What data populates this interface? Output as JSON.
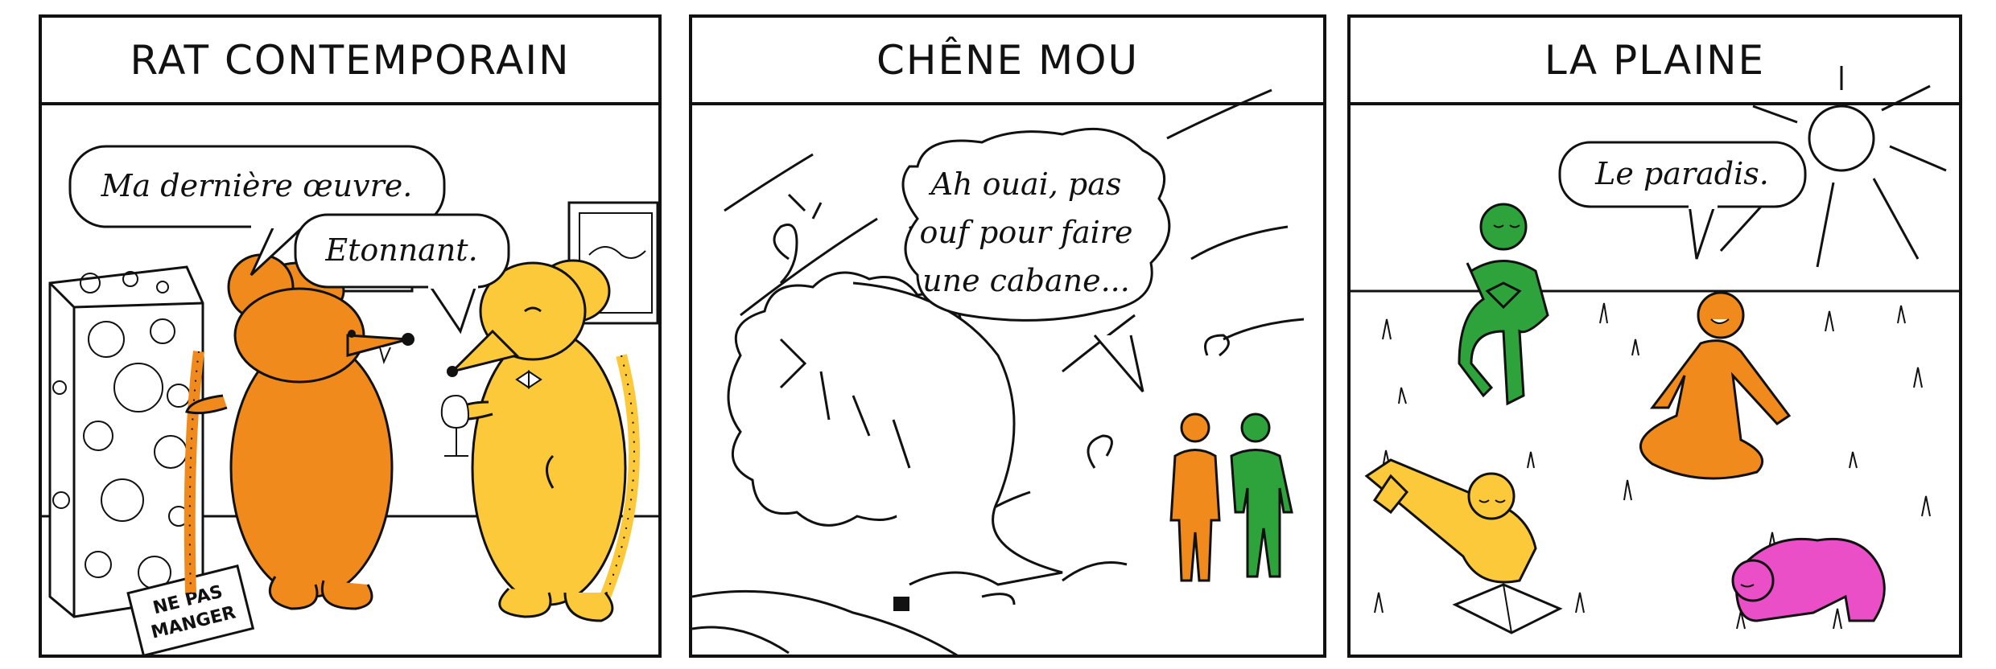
{
  "panels": [
    {
      "title": "RAT CONTEMPORAIN",
      "bubbles": [
        "Ma dernière œuvre.",
        "Etonnant."
      ],
      "sign": [
        "NE PAS",
        "MANGER"
      ]
    },
    {
      "title": "CHÊNE MOU",
      "bubble_lines": [
        "Ah ouai, pas",
        "ouf pour faire",
        "une cabane..."
      ]
    },
    {
      "title": "LA PLAINE",
      "bubbles": [
        "Le paradis."
      ]
    }
  ],
  "colors": {
    "orange": "#f08a1c",
    "yellow": "#fcc93a",
    "green": "#2fa33b",
    "pink": "#ea4fc8",
    "ink": "#111111"
  }
}
